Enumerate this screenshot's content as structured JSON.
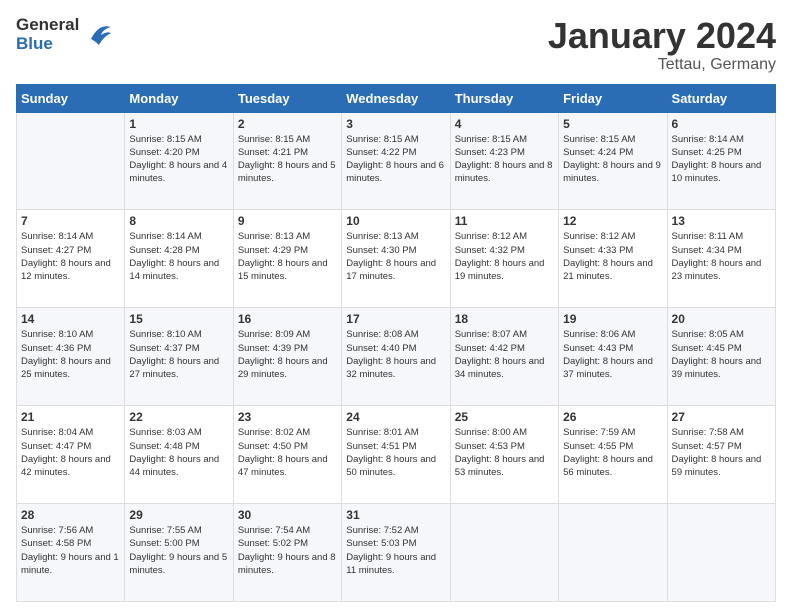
{
  "header": {
    "logo_general": "General",
    "logo_blue": "Blue",
    "title": "January 2024",
    "location": "Tettau, Germany"
  },
  "weekdays": [
    "Sunday",
    "Monday",
    "Tuesday",
    "Wednesday",
    "Thursday",
    "Friday",
    "Saturday"
  ],
  "weeks": [
    [
      {
        "day": "",
        "sunrise": "",
        "sunset": "",
        "daylight": ""
      },
      {
        "day": "1",
        "sunrise": "Sunrise: 8:15 AM",
        "sunset": "Sunset: 4:20 PM",
        "daylight": "Daylight: 8 hours and 4 minutes."
      },
      {
        "day": "2",
        "sunrise": "Sunrise: 8:15 AM",
        "sunset": "Sunset: 4:21 PM",
        "daylight": "Daylight: 8 hours and 5 minutes."
      },
      {
        "day": "3",
        "sunrise": "Sunrise: 8:15 AM",
        "sunset": "Sunset: 4:22 PM",
        "daylight": "Daylight: 8 hours and 6 minutes."
      },
      {
        "day": "4",
        "sunrise": "Sunrise: 8:15 AM",
        "sunset": "Sunset: 4:23 PM",
        "daylight": "Daylight: 8 hours and 8 minutes."
      },
      {
        "day": "5",
        "sunrise": "Sunrise: 8:15 AM",
        "sunset": "Sunset: 4:24 PM",
        "daylight": "Daylight: 8 hours and 9 minutes."
      },
      {
        "day": "6",
        "sunrise": "Sunrise: 8:14 AM",
        "sunset": "Sunset: 4:25 PM",
        "daylight": "Daylight: 8 hours and 10 minutes."
      }
    ],
    [
      {
        "day": "7",
        "sunrise": "Sunrise: 8:14 AM",
        "sunset": "Sunset: 4:27 PM",
        "daylight": "Daylight: 8 hours and 12 minutes."
      },
      {
        "day": "8",
        "sunrise": "Sunrise: 8:14 AM",
        "sunset": "Sunset: 4:28 PM",
        "daylight": "Daylight: 8 hours and 14 minutes."
      },
      {
        "day": "9",
        "sunrise": "Sunrise: 8:13 AM",
        "sunset": "Sunset: 4:29 PM",
        "daylight": "Daylight: 8 hours and 15 minutes."
      },
      {
        "day": "10",
        "sunrise": "Sunrise: 8:13 AM",
        "sunset": "Sunset: 4:30 PM",
        "daylight": "Daylight: 8 hours and 17 minutes."
      },
      {
        "day": "11",
        "sunrise": "Sunrise: 8:12 AM",
        "sunset": "Sunset: 4:32 PM",
        "daylight": "Daylight: 8 hours and 19 minutes."
      },
      {
        "day": "12",
        "sunrise": "Sunrise: 8:12 AM",
        "sunset": "Sunset: 4:33 PM",
        "daylight": "Daylight: 8 hours and 21 minutes."
      },
      {
        "day": "13",
        "sunrise": "Sunrise: 8:11 AM",
        "sunset": "Sunset: 4:34 PM",
        "daylight": "Daylight: 8 hours and 23 minutes."
      }
    ],
    [
      {
        "day": "14",
        "sunrise": "Sunrise: 8:10 AM",
        "sunset": "Sunset: 4:36 PM",
        "daylight": "Daylight: 8 hours and 25 minutes."
      },
      {
        "day": "15",
        "sunrise": "Sunrise: 8:10 AM",
        "sunset": "Sunset: 4:37 PM",
        "daylight": "Daylight: 8 hours and 27 minutes."
      },
      {
        "day": "16",
        "sunrise": "Sunrise: 8:09 AM",
        "sunset": "Sunset: 4:39 PM",
        "daylight": "Daylight: 8 hours and 29 minutes."
      },
      {
        "day": "17",
        "sunrise": "Sunrise: 8:08 AM",
        "sunset": "Sunset: 4:40 PM",
        "daylight": "Daylight: 8 hours and 32 minutes."
      },
      {
        "day": "18",
        "sunrise": "Sunrise: 8:07 AM",
        "sunset": "Sunset: 4:42 PM",
        "daylight": "Daylight: 8 hours and 34 minutes."
      },
      {
        "day": "19",
        "sunrise": "Sunrise: 8:06 AM",
        "sunset": "Sunset: 4:43 PM",
        "daylight": "Daylight: 8 hours and 37 minutes."
      },
      {
        "day": "20",
        "sunrise": "Sunrise: 8:05 AM",
        "sunset": "Sunset: 4:45 PM",
        "daylight": "Daylight: 8 hours and 39 minutes."
      }
    ],
    [
      {
        "day": "21",
        "sunrise": "Sunrise: 8:04 AM",
        "sunset": "Sunset: 4:47 PM",
        "daylight": "Daylight: 8 hours and 42 minutes."
      },
      {
        "day": "22",
        "sunrise": "Sunrise: 8:03 AM",
        "sunset": "Sunset: 4:48 PM",
        "daylight": "Daylight: 8 hours and 44 minutes."
      },
      {
        "day": "23",
        "sunrise": "Sunrise: 8:02 AM",
        "sunset": "Sunset: 4:50 PM",
        "daylight": "Daylight: 8 hours and 47 minutes."
      },
      {
        "day": "24",
        "sunrise": "Sunrise: 8:01 AM",
        "sunset": "Sunset: 4:51 PM",
        "daylight": "Daylight: 8 hours and 50 minutes."
      },
      {
        "day": "25",
        "sunrise": "Sunrise: 8:00 AM",
        "sunset": "Sunset: 4:53 PM",
        "daylight": "Daylight: 8 hours and 53 minutes."
      },
      {
        "day": "26",
        "sunrise": "Sunrise: 7:59 AM",
        "sunset": "Sunset: 4:55 PM",
        "daylight": "Daylight: 8 hours and 56 minutes."
      },
      {
        "day": "27",
        "sunrise": "Sunrise: 7:58 AM",
        "sunset": "Sunset: 4:57 PM",
        "daylight": "Daylight: 8 hours and 59 minutes."
      }
    ],
    [
      {
        "day": "28",
        "sunrise": "Sunrise: 7:56 AM",
        "sunset": "Sunset: 4:58 PM",
        "daylight": "Daylight: 9 hours and 1 minute."
      },
      {
        "day": "29",
        "sunrise": "Sunrise: 7:55 AM",
        "sunset": "Sunset: 5:00 PM",
        "daylight": "Daylight: 9 hours and 5 minutes."
      },
      {
        "day": "30",
        "sunrise": "Sunrise: 7:54 AM",
        "sunset": "Sunset: 5:02 PM",
        "daylight": "Daylight: 9 hours and 8 minutes."
      },
      {
        "day": "31",
        "sunrise": "Sunrise: 7:52 AM",
        "sunset": "Sunset: 5:03 PM",
        "daylight": "Daylight: 9 hours and 11 minutes."
      },
      {
        "day": "",
        "sunrise": "",
        "sunset": "",
        "daylight": ""
      },
      {
        "day": "",
        "sunrise": "",
        "sunset": "",
        "daylight": ""
      },
      {
        "day": "",
        "sunrise": "",
        "sunset": "",
        "daylight": ""
      }
    ]
  ]
}
